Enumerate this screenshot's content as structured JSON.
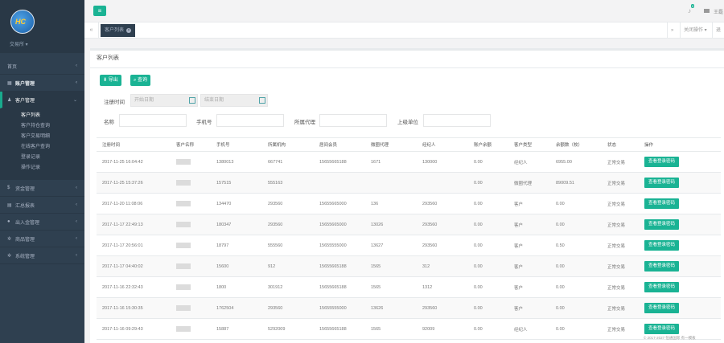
{
  "sidebar": {
    "user": "交易所 ▾",
    "items": [
      {
        "label": "首页",
        "icon": "home-icon"
      },
      {
        "label": "账户管理",
        "icon": "table-icon"
      },
      {
        "label": "客户管理",
        "icon": "user-icon"
      },
      {
        "label": "资金管理",
        "icon": "dollar-icon"
      },
      {
        "label": "汇总报表",
        "icon": "file-icon"
      },
      {
        "label": "出入金管理",
        "icon": "circle-icon"
      },
      {
        "label": "商品管理",
        "icon": "gear-icon"
      },
      {
        "label": "系统管理",
        "icon": "gear-icon"
      }
    ],
    "sub_items": [
      "客户列表",
      "客户持仓查询",
      "客户交易明细",
      "在线客户查询",
      "登录记录",
      "操作记录"
    ]
  },
  "topbar": {
    "badge": "0",
    "user": "王磊"
  },
  "tabs": {
    "active": "客户列表",
    "right_1": "关闭操作 ▾",
    "right_2": "退"
  },
  "panel": {
    "title": "客户列表",
    "export_label": "导出",
    "search_label": "查询",
    "filters": {
      "reg_time_label": "注册时间",
      "start_placeholder": "开始日期",
      "end_placeholder": "结束日期",
      "name_label": "名称",
      "phone_label": "手机号",
      "agent_label": "所属代理",
      "parent_label": "上级单位"
    }
  },
  "table": {
    "headers": [
      "注册时间",
      "客户名称",
      "手机号",
      "所属机构",
      "居间会员",
      "微圈代理",
      "经纪人",
      "账户余额",
      "客户类型",
      "余额数（枚）",
      "状态",
      "操作"
    ],
    "action_label": "查看登录密码",
    "rows": [
      [
        "2017-11-25 16:04:42",
        "",
        "1380013",
        "667741",
        "15655665188",
        "1671",
        "130000",
        "0.00",
        "经纪人",
        "6955.00",
        "正常交易"
      ],
      [
        "2017-11-25 15:37:26",
        "",
        "157515",
        "555163",
        "",
        "",
        "",
        "0.00",
        "微圈代理",
        "89009.51",
        "正常交易"
      ],
      [
        "2017-11-20 11:08:06",
        "",
        "134470",
        "293560",
        "15655665000",
        "136",
        "293560",
        "0.00",
        "客户",
        "0.00",
        "正常交易"
      ],
      [
        "2017-11-17 22:49:13",
        "",
        "180347",
        "293560",
        "15655665000",
        "13026",
        "293560",
        "0.00",
        "客户",
        "0.00",
        "正常交易"
      ],
      [
        "2017-11-17 20:56:01",
        "",
        "18797",
        "555560",
        "15655555000",
        "13627",
        "293560",
        "0.00",
        "客户",
        "0.50",
        "正常交易"
      ],
      [
        "2017-11-17 04:40:02",
        "",
        "15600",
        "912",
        "15655665188",
        "1565",
        "312",
        "0.00",
        "客户",
        "0.00",
        "正常交易"
      ],
      [
        "2017-11-16 22:32:43",
        "",
        "1800",
        "301912",
        "15655665188",
        "1565",
        "1312",
        "0.00",
        "客户",
        "0.00",
        "正常交易"
      ],
      [
        "2017-11-16 15:30:35",
        "",
        "1762504",
        "293560",
        "15655555000",
        "13626",
        "293560",
        "0.00",
        "客户",
        "0.00",
        "正常交易"
      ],
      [
        "2017-11-16 09:29:43",
        "",
        "15887",
        "5292009",
        "15655665188",
        "1565",
        "92009",
        "0.00",
        "经纪人",
        "0.00",
        "正常交易"
      ]
    ]
  },
  "footer": "© 2017-2027 恒通国际 有一模板"
}
